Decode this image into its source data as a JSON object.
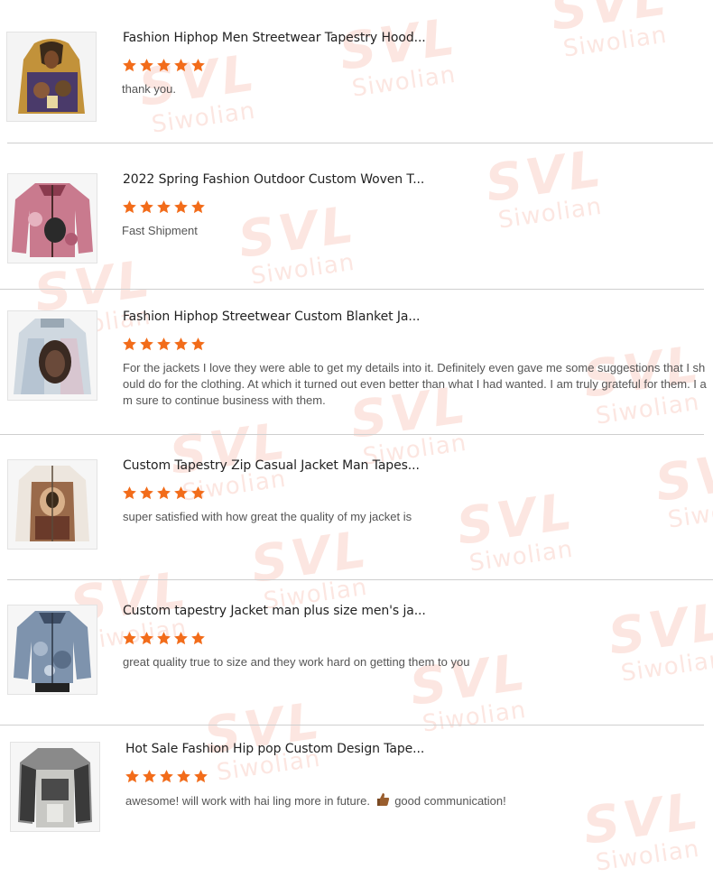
{
  "watermark": {
    "brand": "SVL",
    "name": "Siwolian"
  },
  "reviews": [
    {
      "title": "Fashion Hiphop Men Streetwear Tapestry Hood...",
      "rating": 5,
      "comment": "thank you.",
      "thumb": "hoodie-portrait-icon"
    },
    {
      "title": "2022 Spring Fashion Outdoor Custom Woven T...",
      "rating": 5,
      "comment": "Fast Shipment",
      "thumb": "pink-jacket-icon"
    },
    {
      "title": "Fashion Hiphop Streetwear Custom Blanket Ja...",
      "rating": 5,
      "comment": "For the jackets I love they were able to get my details into it. Definitely even gave me some suggestions that I should do for the clothing. At which it turned out even better than what I had wanted. I am truly grateful for them. I am sure to continue business with them.",
      "thumb": "portrait-jacket-icon"
    },
    {
      "title": "Custom Tapestry Zip Casual Jacket Man Tapes...",
      "rating": 5,
      "comment": "super satisfied with how great the quality of my jacket is",
      "thumb": "tapestry-jacket-icon"
    },
    {
      "title": "Custom tapestry Jacket man plus size men's ja...",
      "rating": 5,
      "comment": "great quality true to size and they work hard on getting them to you",
      "thumb": "blue-jacket-icon"
    },
    {
      "title": "Hot Sale Fashion Hip pop Custom Design Tape...",
      "rating": 5,
      "comment_before": "awesome! will work with hai ling more in future.",
      "comment_after": "good communication!",
      "emoji": "thumbs-up-icon",
      "thumb": "grey-jacket-icon"
    }
  ],
  "colors": {
    "star": "#f26c1a",
    "divider": "#cfcfcf",
    "watermark": "#ef6c4a"
  }
}
